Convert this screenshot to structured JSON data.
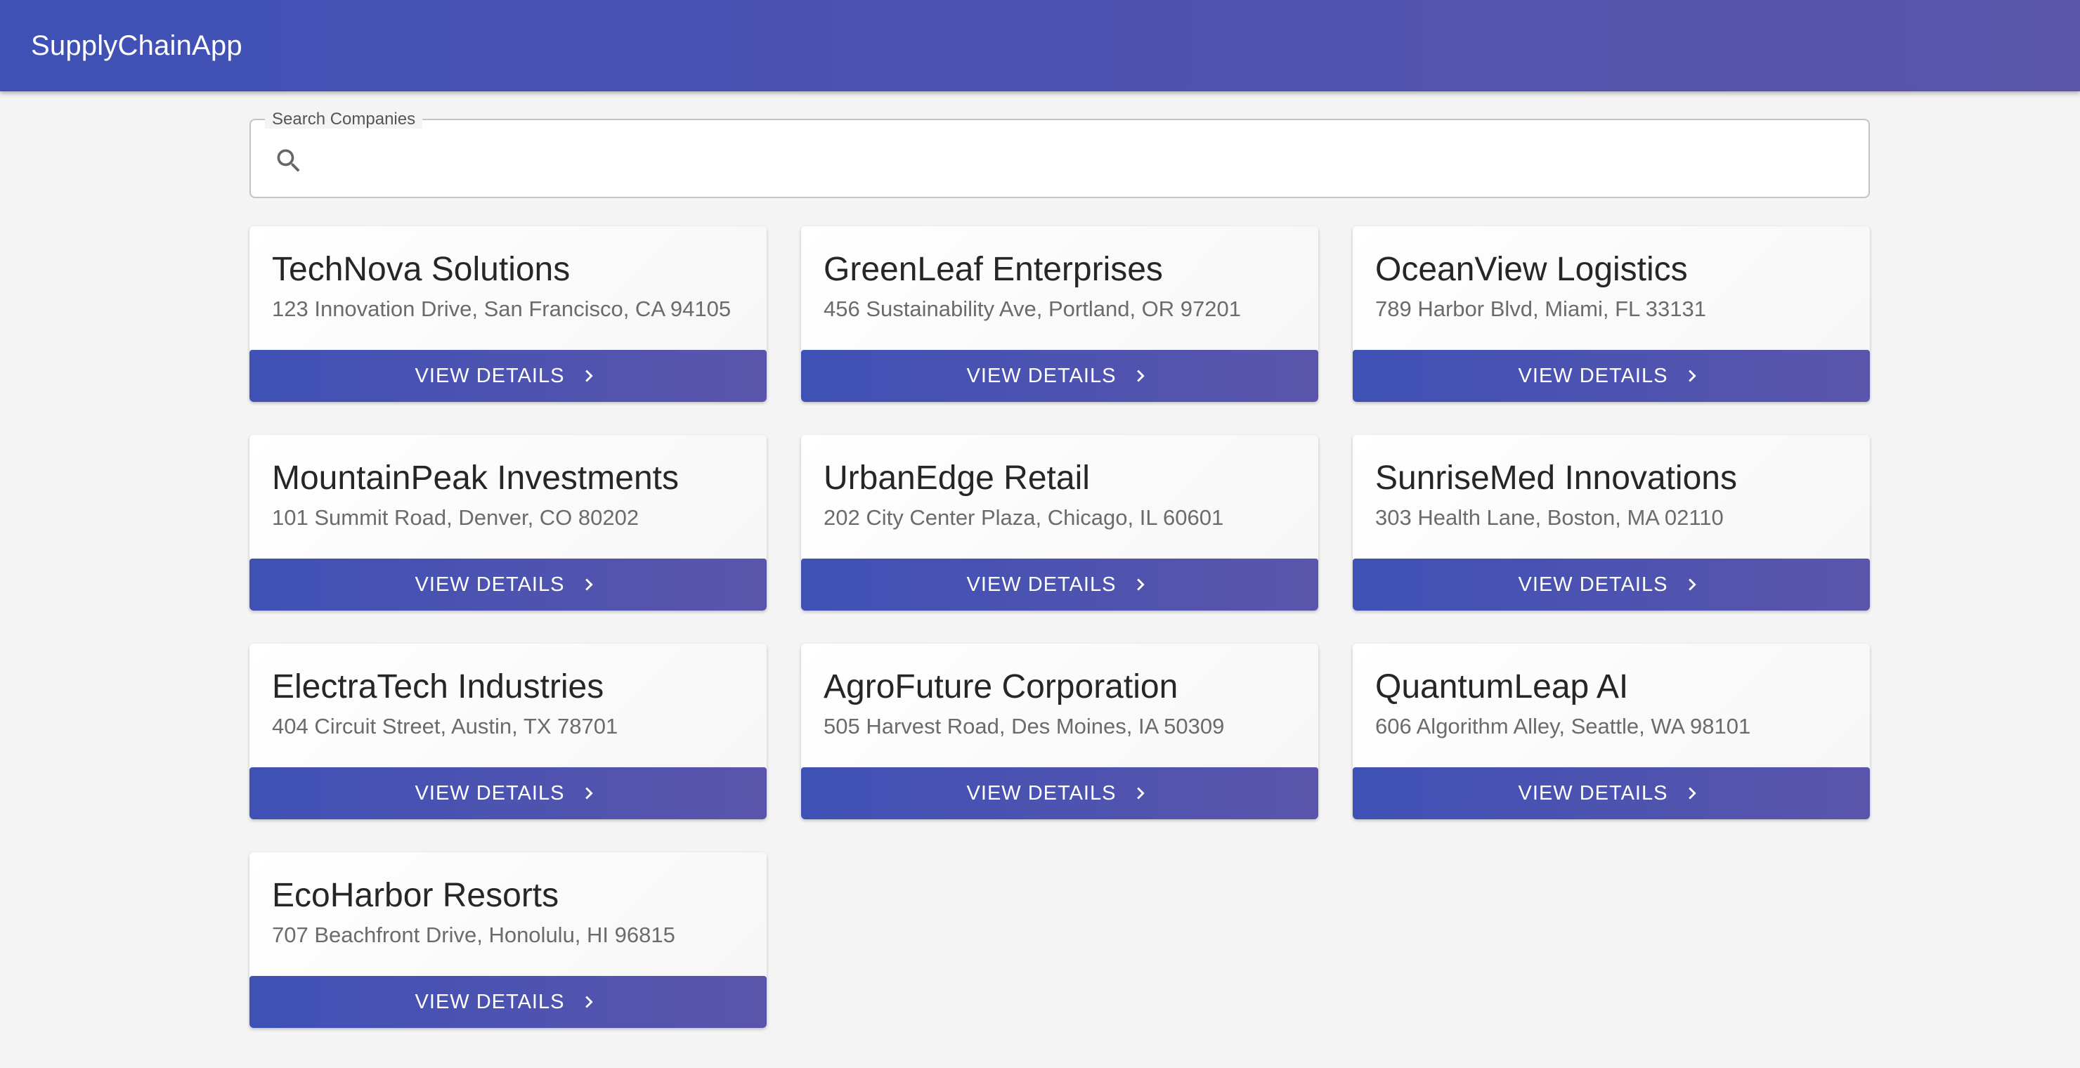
{
  "app": {
    "title": "SupplyChainApp"
  },
  "search": {
    "label": "Search Companies",
    "value": "",
    "placeholder": "",
    "icon": "search-icon"
  },
  "theme": {
    "primary": "#3f51b5",
    "primary_end": "#5a55ab",
    "background": "#f4f4f4"
  },
  "companies": [
    {
      "name": "TechNova Solutions",
      "address": "123 Innovation Drive, San Francisco, CA 94105",
      "button_label": "VIEW DETAILS"
    },
    {
      "name": "GreenLeaf Enterprises",
      "address": "456 Sustainability Ave, Portland, OR 97201",
      "button_label": "VIEW DETAILS"
    },
    {
      "name": "OceanView Logistics",
      "address": "789 Harbor Blvd, Miami, FL 33131",
      "button_label": "VIEW DETAILS"
    },
    {
      "name": "MountainPeak Investments",
      "address": "101 Summit Road, Denver, CO 80202",
      "button_label": "VIEW DETAILS"
    },
    {
      "name": "UrbanEdge Retail",
      "address": "202 City Center Plaza, Chicago, IL 60601",
      "button_label": "VIEW DETAILS"
    },
    {
      "name": "SunriseMed Innovations",
      "address": "303 Health Lane, Boston, MA 02110",
      "button_label": "VIEW DETAILS"
    },
    {
      "name": "ElectraTech Industries",
      "address": "404 Circuit Street, Austin, TX 78701",
      "button_label": "VIEW DETAILS"
    },
    {
      "name": "AgroFuture Corporation",
      "address": "505 Harvest Road, Des Moines, IA 50309",
      "button_label": "VIEW DETAILS"
    },
    {
      "name": "QuantumLeap AI",
      "address": "606 Algorithm Alley, Seattle, WA 98101",
      "button_label": "VIEW DETAILS"
    },
    {
      "name": "EcoHarbor Resorts",
      "address": "707 Beachfront Drive, Honolulu, HI 96815",
      "button_label": "VIEW DETAILS"
    }
  ]
}
